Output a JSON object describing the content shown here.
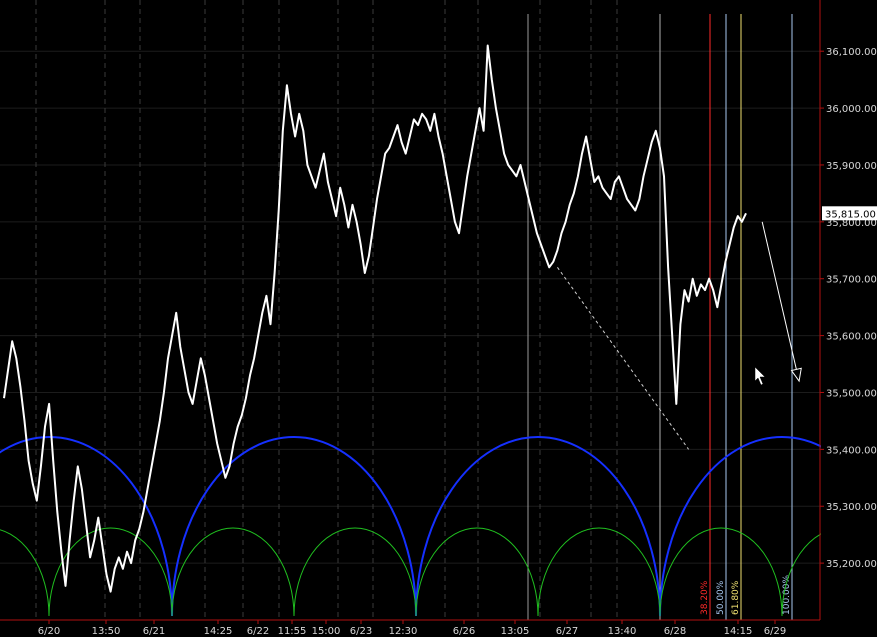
{
  "chart_data": {
    "type": "line",
    "title": "",
    "xlabel": "",
    "ylabel": "",
    "ylim": [
      35100,
      36190
    ],
    "y_ticks": [
      35200,
      35300,
      35400,
      35500,
      35600,
      35700,
      35800,
      35900,
      36000,
      36100
    ],
    "y_tick_labels": [
      "35,200.00",
      "35,300.00",
      "35,400.00",
      "35,500.00",
      "35,600.00",
      "35,700.00",
      "35,800.00",
      "35,900.00",
      "36,000.00",
      "36,100.00"
    ],
    "last_price": 35815,
    "last_price_label": "35,815.00",
    "x_labels": [
      "6/20",
      "13:50",
      "6/21",
      "14:25",
      "6/22",
      "11:55",
      "15:00",
      "6/23",
      "12:30",
      "6/26",
      "13:05",
      "6/27",
      "13:40",
      "6/28",
      "14:15",
      "6/29"
    ],
    "series": [
      {
        "values": [
          35490,
          35540,
          35590,
          35560,
          35510,
          35450,
          35380,
          35340,
          35310,
          35370,
          35440,
          35480,
          35380,
          35290,
          35220,
          35160,
          35240,
          35310,
          35370,
          35330,
          35270,
          35210,
          35240,
          35280,
          35230,
          35180,
          35150,
          35190,
          35210,
          35190,
          35220,
          35200,
          35240,
          35260,
          35290,
          35330,
          35370,
          35410,
          35450,
          35500,
          35560,
          35600,
          35640,
          35580,
          35540,
          35500,
          35480,
          35520,
          35560,
          35530,
          35490,
          35450,
          35410,
          35380,
          35350,
          35370,
          35410,
          35440,
          35460,
          35490,
          35530,
          35560,
          35600,
          35640,
          35670,
          35620,
          35710,
          35820,
          35960,
          36040,
          35990,
          35950,
          35990,
          35960,
          35900,
          35880,
          35860,
          35890,
          35920,
          35870,
          35840,
          35810,
          35860,
          35830,
          35790,
          35830,
          35800,
          35760,
          35710,
          35740,
          35790,
          35840,
          35880,
          35920,
          35930,
          35950,
          35970,
          35940,
          35920,
          35950,
          35980,
          35970,
          35990,
          35980,
          35960,
          35990,
          35950,
          35920,
          35880,
          35840,
          35800,
          35780,
          35830,
          35880,
          35920,
          35960,
          36000,
          35960,
          36110,
          36050,
          36000,
          35960,
          35920,
          35900,
          35890,
          35880,
          35900,
          35870,
          35840,
          35810,
          35780,
          35760,
          35740,
          35720,
          35730,
          35750,
          35780,
          35800,
          35830,
          35850,
          35880,
          35920,
          35950,
          35910,
          35870,
          35880,
          35860,
          35850,
          35840,
          35870,
          35880,
          35860,
          35840,
          35830,
          35820,
          35840,
          35880,
          35910,
          35940,
          35960,
          35930,
          35880,
          35720,
          35600,
          35480,
          35620,
          35680,
          35660,
          35700,
          35670,
          35690,
          35680,
          35700,
          35680,
          35650,
          35690,
          35730,
          35760,
          35790,
          35810,
          35800,
          35815
        ],
        "color": "#ffffff"
      }
    ],
    "trend_line": {
      "from": {
        "index": 135,
        "value": 35720
      },
      "to": {
        "index": 167,
        "value": 35400
      },
      "color": "#d0d0d0",
      "style": "dashed"
    },
    "projection_arrow": {
      "from": {
        "index": 183,
        "value": 35800
      },
      "to": {
        "index": 192,
        "value": 35520
      },
      "color": "#ffffff"
    },
    "fib_levels": [
      {
        "label": "38.20%",
        "color": "#ff2a2a"
      },
      {
        "label": "50.00%",
        "color": "#a8c8f0"
      },
      {
        "label": "61.80%",
        "color": "#f0e070"
      },
      {
        "label": "100.00%",
        "color": "#a8c8f0"
      }
    ],
    "cycle_arcs": [
      {
        "color": "#1530ff",
        "period": "long"
      },
      {
        "color": "#20c020",
        "period": "short"
      }
    ],
    "grid": true,
    "background": "#000000",
    "axis_color": "#b01010"
  }
}
